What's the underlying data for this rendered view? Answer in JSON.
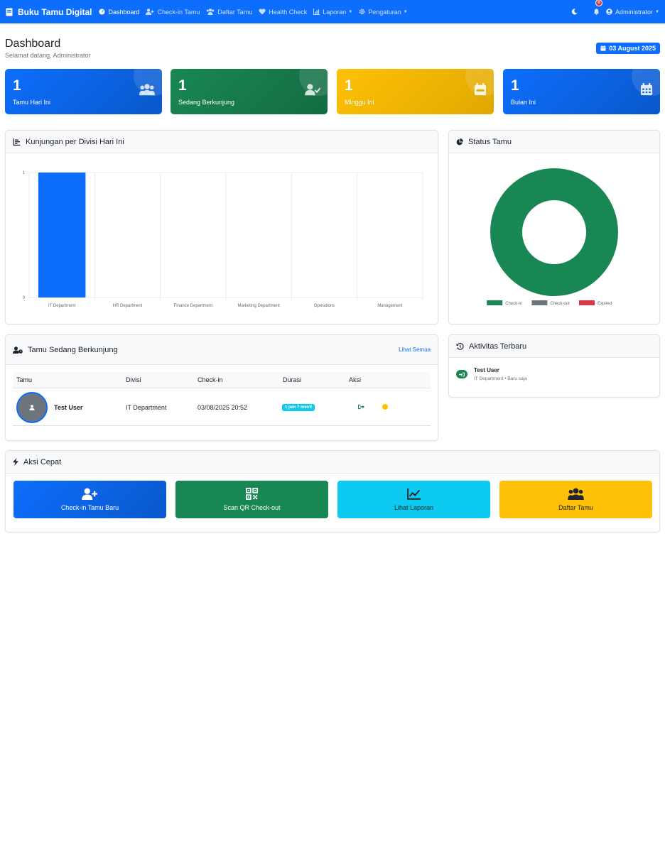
{
  "navbar": {
    "brand": "Buku Tamu Digital",
    "items": [
      {
        "label": "Dashboard",
        "icon": "gauge-icon",
        "active": true
      },
      {
        "label": "Check-in Tamu",
        "icon": "user-plus-icon"
      },
      {
        "label": "Daftar Tamu",
        "icon": "users-icon"
      },
      {
        "label": "Health Check",
        "icon": "heart-pulse-icon"
      },
      {
        "label": "Laporan",
        "icon": "chart-bar-icon",
        "dropdown": true
      },
      {
        "label": "Pengaturan",
        "icon": "gear-icon",
        "dropdown": true
      }
    ],
    "notification_count": "0",
    "user": "Administrator"
  },
  "header": {
    "title": "Dashboard",
    "subtitle": "Selamat datang, Administrator",
    "date": "03 August 2025"
  },
  "stats": [
    {
      "value": "1",
      "label": "Tamu Hari Ini",
      "icon": "users-icon",
      "color": "#0d6efd"
    },
    {
      "value": "1",
      "label": "Sedang Berkunjung",
      "icon": "user-check-icon",
      "color": "#198754"
    },
    {
      "value": "1",
      "label": "Minggu Ini",
      "icon": "calendar-week-icon",
      "color": "#ffc107"
    },
    {
      "value": "1",
      "label": "Bulan Ini",
      "icon": "calendar-icon",
      "color": "#0d6efd"
    }
  ],
  "division_chart": {
    "title": "Kunjungan per Divisi Hari Ini"
  },
  "status_chart": {
    "title": "Status Tamu"
  },
  "chart_data": [
    {
      "type": "bar",
      "categories": [
        "IT Department",
        "HR Department",
        "Finance Department",
        "Marketing Department",
        "Operations",
        "Management"
      ],
      "values": [
        1,
        0,
        0,
        0,
        0,
        0
      ],
      "ylim": [
        0,
        1
      ],
      "yticks": [
        "0",
        "1"
      ],
      "color": "#0d6efd",
      "grid": true
    },
    {
      "type": "pie",
      "labels": [
        "Check-in",
        "Check-out",
        "Expired"
      ],
      "values": [
        1,
        0,
        0
      ],
      "colors": [
        "#198754",
        "#6c757d",
        "#dc3545"
      ],
      "legend": "bottom"
    }
  ],
  "visiting": {
    "title": "Tamu Sedang Berkunjung",
    "view_all": "Lihat Semua",
    "columns": [
      "Tamu",
      "Divisi",
      "Check-in",
      "Durasi",
      "Aksi"
    ],
    "rows": [
      {
        "name": "Test User",
        "division": "IT Department",
        "checkin": "03/08/2025 20:52",
        "duration": "1 jam 7 menit"
      }
    ]
  },
  "activity": {
    "title": "Aktivitas Terbaru",
    "items": [
      {
        "name": "Test User",
        "detail": "IT Department • Baru saja"
      }
    ]
  },
  "quick_actions": {
    "title": "Aksi Cepat",
    "items": [
      {
        "label": "Check-in Tamu Baru",
        "icon": "user-plus-icon",
        "color": "#0d6efd"
      },
      {
        "label": "Scan QR Check-out",
        "icon": "qrcode-icon",
        "color": "#198754"
      },
      {
        "label": "Lihat Laporan",
        "icon": "chart-line-icon",
        "color": "#0dcaf0"
      },
      {
        "label": "Daftar Tamu",
        "icon": "users-icon",
        "color": "#ffc107"
      }
    ]
  }
}
